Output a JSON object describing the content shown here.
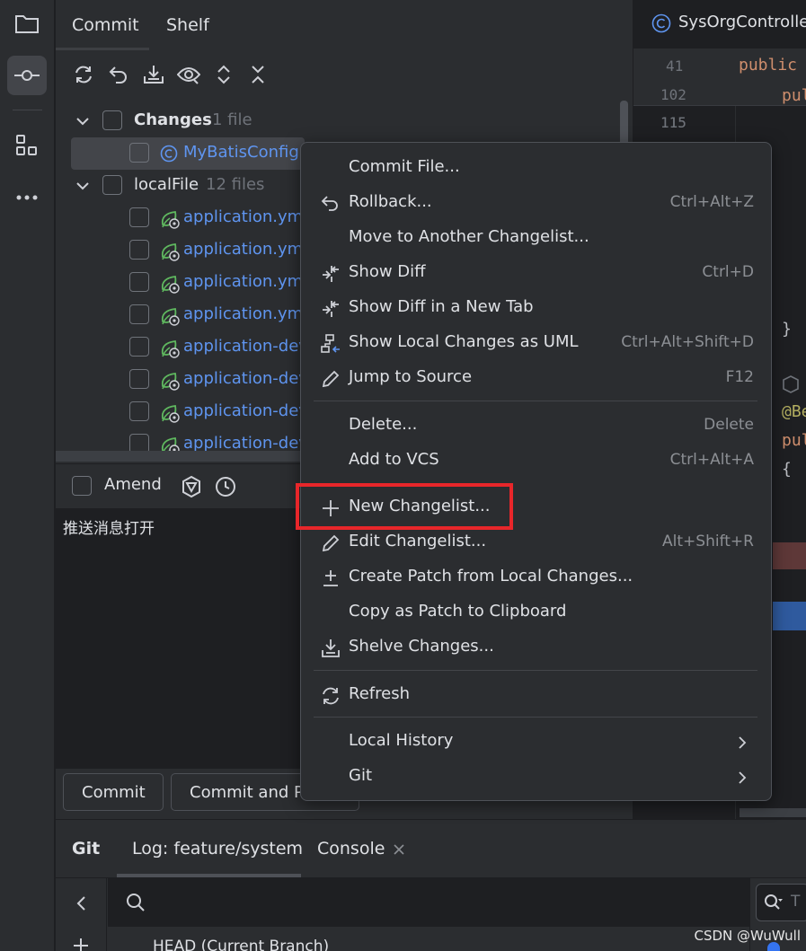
{
  "commit_panel": {
    "tabs": [
      {
        "label": "Commit",
        "active": true
      },
      {
        "label": "Shelf",
        "active": false
      }
    ],
    "tree": {
      "changes": {
        "label": "Changes",
        "count": "1 file"
      },
      "changes_file": "MyBatisConfig.",
      "localfile": {
        "label": "localFile",
        "count": "12 files"
      },
      "files": [
        "application.yml",
        "application.yml",
        "application.yml",
        "application.yml",
        "application-dev",
        "application-dev",
        "application-dev",
        "application-dev"
      ]
    },
    "amend_label": "Amend",
    "message": "推送消息打开",
    "commit_button": "Commit",
    "commit_push_button": "Commit and P"
  },
  "editor": {
    "tab_title": "SysOrgControlle",
    "line_numbers": [
      "41",
      "102",
      "115"
    ],
    "code": {
      "line41": "public",
      "line102": "pul",
      "brace_close": "}",
      "annotation": "@Be",
      "pub": "pul",
      "brace_open": "{"
    }
  },
  "bottom_panel": {
    "tabs": [
      {
        "label": "Git"
      },
      {
        "label": "Log: feature/system"
      },
      {
        "label": "Console"
      }
    ],
    "head_text": "HEAD (Current Branch)",
    "search_placeholder": "T"
  },
  "context_menu": {
    "items": [
      {
        "label": "Commit File...",
        "shortcut": ""
      },
      {
        "label": "Rollback...",
        "shortcut": "Ctrl+Alt+Z"
      },
      {
        "label": "Move to Another Changelist...",
        "shortcut": ""
      },
      {
        "label": "Show Diff",
        "shortcut": "Ctrl+D"
      },
      {
        "label": "Show Diff in a New Tab",
        "shortcut": ""
      },
      {
        "label": "Show Local Changes as UML",
        "shortcut": "Ctrl+Alt+Shift+D"
      },
      {
        "label": "Jump to Source",
        "shortcut": "F12"
      },
      {
        "label": "Delete...",
        "shortcut": "Delete"
      },
      {
        "label": "Add to VCS",
        "shortcut": "Ctrl+Alt+A"
      },
      {
        "label": "New Changelist...",
        "shortcut": ""
      },
      {
        "label": "Edit Changelist...",
        "shortcut": "Alt+Shift+R"
      },
      {
        "label": "Create Patch from Local Changes...",
        "shortcut": ""
      },
      {
        "label": "Copy as Patch to Clipboard",
        "shortcut": ""
      },
      {
        "label": "Shelve Changes...",
        "shortcut": ""
      },
      {
        "label": "Refresh",
        "shortcut": ""
      },
      {
        "label": "Local History",
        "shortcut": ""
      },
      {
        "label": "Git",
        "shortcut": ""
      }
    ]
  },
  "watermark": "CSDN @WuWull",
  "colors": {
    "highlight": "#e8262a",
    "accent_blue": "#5f95f0",
    "background": "#2b2d30"
  }
}
